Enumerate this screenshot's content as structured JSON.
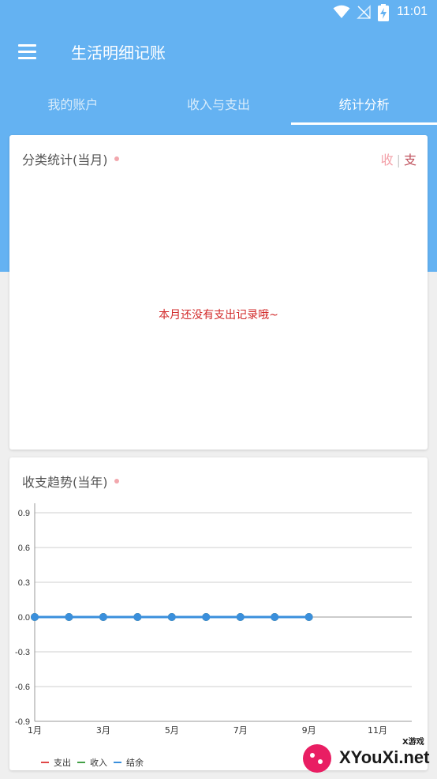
{
  "status_bar": {
    "time": "11:01"
  },
  "app_bar": {
    "title": "生活明细记账",
    "menu_icon": "hamburger-menu-icon"
  },
  "tabs": [
    {
      "label": "我的账户",
      "active": false
    },
    {
      "label": "收入与支出",
      "active": false
    },
    {
      "label": "统计分析",
      "active": true
    }
  ],
  "category_card": {
    "title": "分类统计(当月)",
    "toggle_income": "收",
    "toggle_separator": "|",
    "toggle_expense": "支",
    "empty_message": "本月还没有支出记录哦~"
  },
  "trend_card": {
    "title": "收支趋势(当年)"
  },
  "colors": {
    "primary": "#64b2f2",
    "expense": "#e04848",
    "income": "#43a047",
    "balance": "#3a8fdc"
  },
  "chart_data": {
    "type": "line",
    "x": [
      1,
      2,
      3,
      4,
      5,
      6,
      7,
      8,
      9
    ],
    "x_tick_labels": [
      "1月",
      "3月",
      "5月",
      "7月",
      "9月",
      "11月"
    ],
    "y_tick_labels": [
      "0.9",
      "0.6",
      "0.3",
      "0.0",
      "-0.3",
      "-0.6",
      "-0.9"
    ],
    "ylim": [
      -0.9,
      0.9
    ],
    "xlim": [
      1,
      12
    ],
    "series": [
      {
        "name": "支出",
        "color": "#e04848",
        "values": [
          0,
          0,
          0,
          0,
          0,
          0,
          0,
          0,
          0
        ]
      },
      {
        "name": "收入",
        "color": "#43a047",
        "values": [
          0,
          0,
          0,
          0,
          0,
          0,
          0,
          0,
          0
        ]
      },
      {
        "name": "结余",
        "color": "#3a8fdc",
        "values": [
          0,
          0,
          0,
          0,
          0,
          0,
          0,
          0,
          0
        ]
      }
    ],
    "grid": true,
    "legend": "bottom-left"
  },
  "watermark": {
    "text": "XYouXi.net",
    "small_text": "X游戏"
  }
}
